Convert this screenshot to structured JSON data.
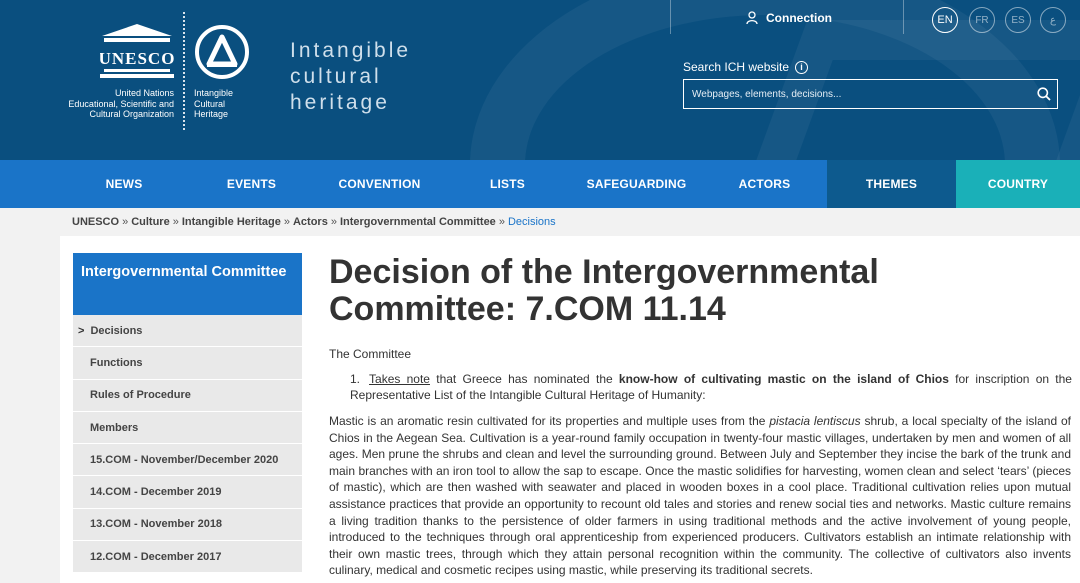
{
  "header": {
    "unesco_logo_text": "UNESCO",
    "unesco_org_lines": [
      "United Nations",
      "Educational, Scientific and",
      "Cultural Organization"
    ],
    "ich_lines": [
      "Intangible",
      "Cultural",
      "Heritage"
    ],
    "site_title_lines": [
      "Intangible",
      "cultural",
      "heritage"
    ],
    "connection_label": "Connection",
    "languages": [
      "EN",
      "FR",
      "ES",
      "ع"
    ],
    "search_label": "Search ICH website",
    "search_placeholder": "Webpages, elements, decisions..."
  },
  "nav": {
    "items": [
      "NEWS",
      "EVENTS",
      "CONVENTION",
      "LISTS",
      "SAFEGUARDING",
      "ACTORS",
      "THEMES",
      "COUNTRY"
    ]
  },
  "breadcrumb": [
    "UNESCO",
    "Culture",
    "Intangible Heritage",
    "Actors",
    "Intergovernmental Committee",
    "Decisions"
  ],
  "sidebar": {
    "heading": "Intergovernmental Committee",
    "items": [
      "Decisions",
      "Functions",
      "Rules of Procedure",
      "Members",
      "15.COM - November/December 2020",
      "14.COM - December 2019",
      "13.COM - November 2018",
      "12.COM - December 2017"
    ]
  },
  "main": {
    "title": "Decision of the Intergovernmental Committee: 7.COM 11.14",
    "lead": "The Committee",
    "item_number": "1.",
    "item_link": "Takes note",
    "item_text_1": " that Greece has nominated the ",
    "item_bold": "know-how of cultivating mastic on the island of Chios",
    "item_text_2": " for inscription on the Representative List of the Intangible Cultural Heritage of Humanity:",
    "para_1": "Mastic is an aromatic resin cultivated for its properties and multiple uses from the ",
    "para_italic": "pistacia lentiscus",
    "para_2": " shrub, a local specialty of the island of Chios in the Aegean Sea. Cultivation is a year-round family occupation in twenty-four mastic villages, undertaken by men and women of all ages. Men prune the shrubs and clean and level the surrounding ground. Between July and September they incise the bark of the trunk and main branches with an iron tool to allow the sap to escape. Once the mastic solidifies for harvesting, women clean and select ‘tears’ (pieces of mastic), which are then washed with seawater and placed in wooden boxes in a cool place. Traditional cultivation relies upon mutual assistance practices that provide an opportunity to recount old tales and stories and renew social ties and networks. Mastic culture remains a living tradition thanks to the persistence of older farmers in using traditional methods and the active involvement of young people, introduced to the techniques through oral apprenticeship from experienced producers. Cultivators establish an intimate relationship with their own mastic trees, through which they attain personal recognition within the community. The collective of cultivators also invents culinary, medical and cosmetic recipes using mastic, while preserving its traditional secrets."
  },
  "colors": {
    "header_bg": "#0a4f7f",
    "nav_bg": "#1a74c8",
    "themes_bg": "#0d5a8e",
    "country_bg": "#1ab0b8",
    "link": "#1a74c8"
  },
  "icons": [
    "unesco-temple-icon",
    "ich-logo-icon",
    "user-icon",
    "info-icon",
    "search-icon"
  ]
}
